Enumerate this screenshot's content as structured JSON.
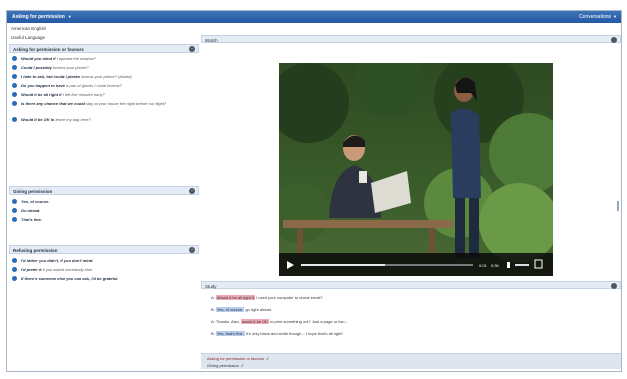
{
  "header": {
    "title": "Asking for permission",
    "right_label": "Conversations"
  },
  "left": {
    "language": "American English",
    "useful_language": "Useful Language",
    "sections": [
      {
        "title": "Asking for permission or favours",
        "phrases": [
          {
            "bold": "Would you mind if",
            "rest": " I opened the window?"
          },
          {
            "bold": "Could I possibly",
            "rest": " borrow your phone?"
          },
          {
            "bold": "I hate to ask, but could I please",
            "rest": " borrow your phone? (Asked)"
          },
          {
            "bold": "Do you happen to have",
            "rest": " a pair of gloves I could borrow?"
          },
          {
            "bold": "Would it be all right if",
            "rest": " I left five minutes early?"
          },
          {
            "bold": "Is there any chance that we could",
            "rest": " stay at your house the night before our flight?"
          },
          {
            "bold": "Would it be OK to",
            "rest": " leave my bag here?"
          }
        ]
      },
      {
        "title": "Giving permission",
        "phrases": [
          {
            "bold": "Yes, of course.",
            "rest": ""
          },
          {
            "bold": "Go ahead.",
            "rest": ""
          },
          {
            "bold": "That's fine.",
            "rest": ""
          }
        ]
      },
      {
        "title": "Refusing permission",
        "phrases": [
          {
            "bold": "I'd rather you didn't, if you don't mind.",
            "rest": ""
          },
          {
            "bold": "I'd prefer it",
            "rest": " if you asked somebody else."
          },
          {
            "bold": "If there's someone else you can ask, I'd be grateful.",
            "rest": ""
          }
        ]
      }
    ]
  },
  "right": {
    "watch_label": "Watch",
    "video": {
      "time_left": "0:01",
      "time_right": "0:30"
    },
    "study_label": "Study",
    "study_lines": [
      {
        "num": "A:",
        "hl": "Would it be all right if",
        "rest": " I used your computer to check email?"
      },
      {
        "num": "B:",
        "hl": "Yes, of course,",
        "rest": " go right ahead."
      },
      {
        "num": "A:",
        "pre": "Thanks. Also, ",
        "hl": "would it be OK",
        "rest": " to print something out? Just a page or two..."
      },
      {
        "num": "B:",
        "hl": "Yes, that's fine.",
        "rest": " It's only black and white though – I hope that's all right!"
      }
    ],
    "footer": {
      "line1": "Asking for permission or favours",
      "line2": "Giving permission"
    }
  },
  "colors": {
    "header_blue": "#2f66ae",
    "highlight_pink": "#f1a9b3",
    "highlight_blue": "#b8ccec"
  }
}
